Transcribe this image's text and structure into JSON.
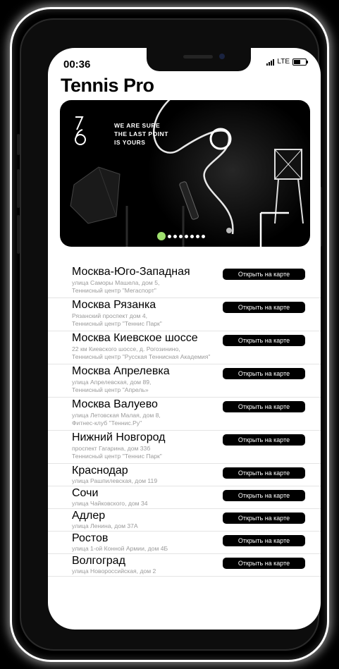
{
  "status_bar": {
    "time": "00:36",
    "network": "LTE"
  },
  "app": {
    "title": "Tennis Pro"
  },
  "banner": {
    "line1": "WE ARE SURE",
    "line2": "THE LAST POINT",
    "line3": "IS YOURS",
    "slides_total": 8,
    "active_slide": 1
  },
  "locations": [
    {
      "name": "Москва-Юго-Западная",
      "address": [
        "улица Саморы Машела, дом 5,",
        "Теннисный центр \"Мегаспорт\""
      ],
      "button": "Открыть на карте"
    },
    {
      "name": "Москва Рязанка",
      "address": [
        "Рязанский проспект дом 4,",
        "Теннисный центр \"Теннис Парк\""
      ],
      "button": "Открыть на карте"
    },
    {
      "name": "Москва Киевское шоссе",
      "address": [
        "22 км Киевского шоссе, д. Рогозинино,",
        "Теннисный центр \"Русская Теннисная Академия\""
      ],
      "button": "Открыть на карте"
    },
    {
      "name": "Москва Апрелевка",
      "address": [
        "улица Апрелевская, дом 89,",
        "Теннисный центр \"Апрель»"
      ],
      "button": "Открыть на карте"
    },
    {
      "name": "Москва Валуево",
      "address": [
        "улица Летовская Малая, дом 8,",
        "Фитнес-клуб \"Теннис.Ру\""
      ],
      "button": "Открыть на карте"
    },
    {
      "name": "Нижний Новгород",
      "address": [
        "проспект Гагарина,  дом 33б",
        "Теннисный центр \"Теннис Парк\""
      ],
      "button": "Открыть на карте"
    },
    {
      "name": "Краснодар",
      "address": [
        "улица Рашпилевская, дом 119"
      ],
      "button": "Открыть на карте"
    },
    {
      "name": "Сочи",
      "address": [
        "улица Чайковского, дом 34"
      ],
      "button": "Открыть на карте"
    },
    {
      "name": "Адлер",
      "address": [
        "улица Ленина, дом 37А"
      ],
      "button": "Открыть на карте"
    },
    {
      "name": "Ростов",
      "address": [
        "улица 1-ой Конной Армии, дом 4Б"
      ],
      "button": "Открыть на карте"
    },
    {
      "name": "Волгоград",
      "address": [
        "улица Новороссийская, дом 2"
      ],
      "button": "Открыть на карте"
    }
  ],
  "colors": {
    "accent_dot": "#9fe06e",
    "button_bg": "#000000",
    "address_text": "#9a9a9a"
  }
}
